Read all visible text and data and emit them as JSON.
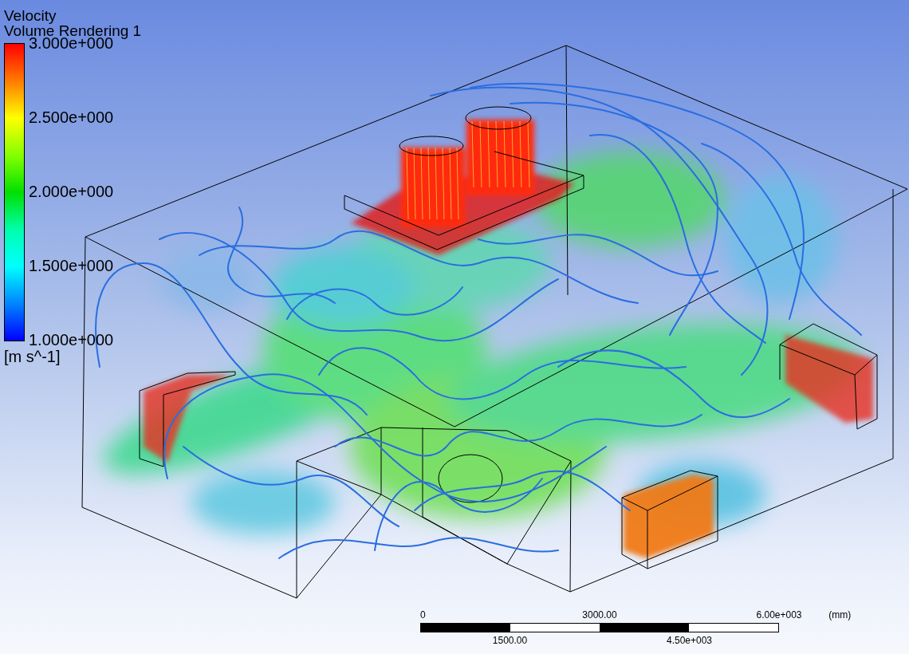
{
  "legend": {
    "title": "Velocity",
    "subtitle": "Volume Rendering 1",
    "ticks": [
      "3.000e+000",
      "2.500e+000",
      "2.000e+000",
      "1.500e+000",
      "1.000e+000"
    ],
    "unit": "[m s^-1]"
  },
  "scale_bar": {
    "top_labels": [
      "0",
      "3000.00",
      "6.00e+003"
    ],
    "bottom_labels": [
      "1500.00",
      "4.50e+003"
    ],
    "unit": "(mm)"
  }
}
